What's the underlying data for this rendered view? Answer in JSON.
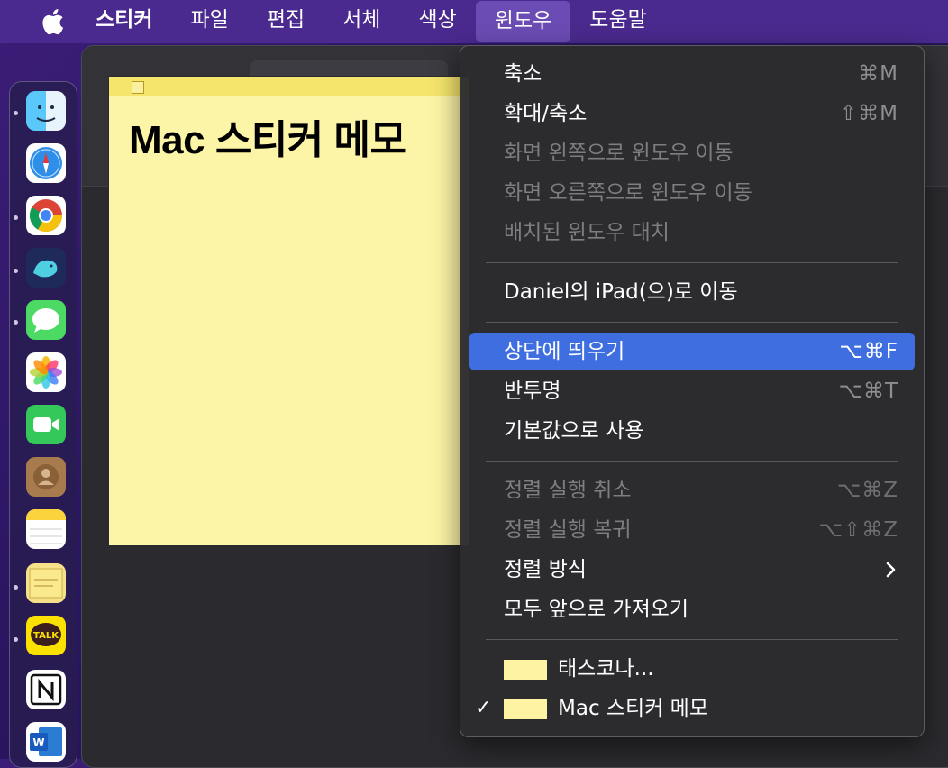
{
  "menubar": {
    "items": [
      "스티커",
      "파일",
      "편집",
      "서체",
      "색상",
      "윈도우",
      "도움말"
    ],
    "active": "윈도우"
  },
  "dock": {
    "apps": [
      "finder-icon",
      "safari-icon",
      "chrome-icon",
      "whale-icon",
      "messages-icon",
      "photos-icon",
      "facetime-icon",
      "contacts-icon",
      "notes-icon",
      "stickies-icon",
      "kakaotalk-icon",
      "notion-icon",
      "word-icon"
    ],
    "kakao_label": "TALK",
    "word_label": "W"
  },
  "sticky": {
    "title": "Mac 스티커 메모"
  },
  "menu": {
    "items": [
      {
        "label": "축소",
        "shortcut": "⌘M",
        "disabled": false
      },
      {
        "label": "확대/축소",
        "shortcut": "⇧⌘M",
        "disabled": false
      },
      {
        "label": "화면 왼쪽으로 윈도우 이동",
        "shortcut": "",
        "disabled": true
      },
      {
        "label": "화면 오른쪽으로 윈도우 이동",
        "shortcut": "",
        "disabled": true
      },
      {
        "label": "배치된 윈도우 대치",
        "shortcut": "",
        "disabled": true
      },
      {
        "label": "Daniel의 iPad(으)로 이동",
        "shortcut": "",
        "disabled": false
      },
      {
        "label": "상단에 띄우기",
        "shortcut": "⌥⌘F",
        "disabled": false,
        "highlighted": true
      },
      {
        "label": "반투명",
        "shortcut": "⌥⌘T",
        "disabled": false
      },
      {
        "label": "기본값으로 사용",
        "shortcut": "",
        "disabled": false
      },
      {
        "label": "정렬 실행 취소",
        "shortcut": "⌥⌘Z",
        "disabled": true
      },
      {
        "label": "정렬 실행 복귀",
        "shortcut": "⌥⇧⌘Z",
        "disabled": true
      },
      {
        "label": "정렬 방식",
        "shortcut": "",
        "disabled": false,
        "submenu": true
      },
      {
        "label": "모두 앞으로 가져오기",
        "shortcut": "",
        "disabled": false
      }
    ],
    "windows": [
      {
        "label": "태스코나...",
        "checked": false,
        "color": "#fdf3a2"
      },
      {
        "label": "Mac 스티커 메모",
        "checked": true,
        "color": "#fdf3a2"
      }
    ],
    "checkmark": "✓",
    "chevron": "›"
  }
}
